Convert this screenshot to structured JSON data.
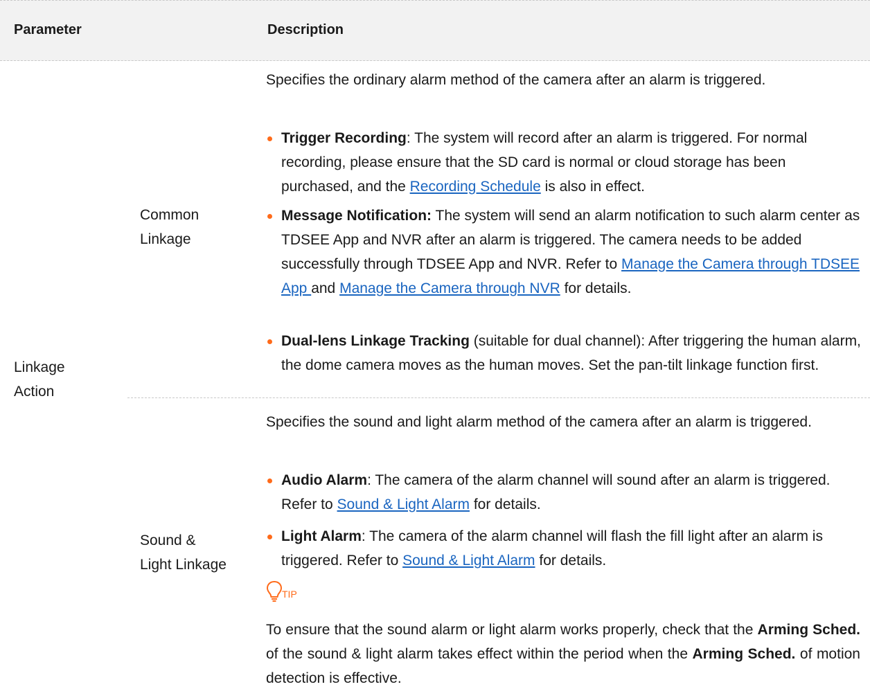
{
  "header": {
    "parameter": "Parameter",
    "description": "Description"
  },
  "row": {
    "parameter_line1": "Linkage",
    "parameter_line2": "Action",
    "common": {
      "name_line1": "Common",
      "name_line2": "Linkage",
      "intro": "Specifies the ordinary alarm method of the camera after an alarm is triggered.",
      "b1_title": "Trigger Recording",
      "b1_text": ": The system will record after an alarm is triggered. For normal recording, please ensure that the SD card is normal or cloud storage has been purchased, and the ",
      "b1_link": "Recording Schedule",
      "b1_end": " is also in effect.",
      "b2_title": "Message Notification:",
      "b2_text": " The system will send an alarm notification to such alarm center as TDSEE App and NVR after an alarm is triggered. The camera needs to be added successfully through TDSEE App and NVR. Refer to ",
      "b2_link1": "Manage the Camera through TDSEE App ",
      "b2_mid": "and ",
      "b2_link2": "Manage the Camera through NVR",
      "b2_end": " for details.",
      "b3_title": "Dual-lens Linkage Tracking",
      "b3_text": " (suitable for dual channel): After triggering the human alarm, the dome camera moves as the human moves. Set the pan-tilt linkage function first."
    },
    "sound": {
      "name_line1": "Sound &",
      "name_line2": "Light Linkage",
      "intro": "Specifies the sound and light alarm method of the camera after an alarm is triggered.",
      "b1_title": "Audio Alarm",
      "b1_text": ": The camera of the alarm channel will sound after an alarm is triggered. Refer to ",
      "b1_link": "Sound & Light Alarm",
      "b1_end": " for details.",
      "b2_title": "Light Alarm",
      "b2_text": ": The camera of the alarm channel will flash the fill light after an alarm is triggered. Refer to ",
      "b2_link": "Sound & Light Alarm",
      "b2_end": " for details.",
      "tip_label": "TIP",
      "tip_t1": "To ensure that the sound alarm or light alarm works properly, check that the ",
      "tip_b1": "Arming Sched.",
      "tip_t2": " of the sound & light alarm takes effect within the period when the ",
      "tip_b2": "Arming Sched.",
      "tip_t3": " of motion detection is effective."
    }
  },
  "colors": {
    "accent": "#ff6b1a",
    "link": "#1a65c0",
    "header_bg": "#f2f2f2"
  }
}
